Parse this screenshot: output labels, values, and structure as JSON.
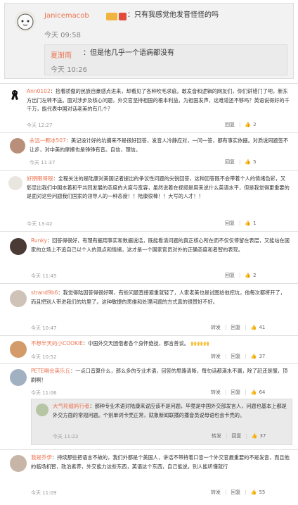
{
  "top_post": {
    "user_name": "Janicemacob",
    "text": "：只有我感觉他发音怪怪的吗",
    "time": "今天 09:58",
    "reply": {
      "user_name": "夏澍雨",
      "text": "：但是他几乎一个语病都没有",
      "time": "今天 10:26"
    }
  },
  "comments": [
    {
      "user_name": "Ann0102",
      "text": "：捡着骄傲的民族自豪感点进来，却看见了各种吹毛求疵。敢发音和逻辑的网友们，你们讲错门了吧，新东方出门左转不送。面对涉步及核心问题，外交官坚持祖国的根本利益，为祖国发声，这难道还不够吗？英语说得好的千千万，能代表中国对话老美的有几个？",
      "time": "今天 12:27",
      "likes": "2"
    },
    {
      "user_name": "永远一颗冰507",
      "text": "：美记设计好的坑摘来不是很好回答，发音人冷静应对，一问一答，都有事实依据。对质说同题签不让步，对中美的摩擦也是铮铮有音。自信，理信。",
      "time": "今天 11:37",
      "likes": "5"
    },
    {
      "user_name": "好朋眼哥程",
      "text": "：全程关注的是陆康对美国记者提出的争议性问题的尖锐回答，这种回答既不会带着个人的情绪色彩，又彰显出我们中国本着和平共同发展的态度的大度与宽容，虽然说着在视频是用来说什么英语水平，但是我觉得更重要的是面对这些问题我们国家的领导人的一种态度！！陆康很棒！！大写的人才！！",
      "time": "今天 13:42",
      "likes": "1"
    },
    {
      "user_name": "Runky",
      "text": "：回答得很好，有理有据用事实和数据说话，既能看清问题的真正核心所在而不仅仅停留在表层，又能站在国家的立场上不追自己以个人的观点和情绪，这才是一个国家官员对外的正确态度和者智的表现。",
      "time": "今天 11:45",
      "likes": "2"
    },
    {
      "user_name": "strand9b6",
      "text": "：我觉得陆因答得很好啊，有些问题直接避重就轻了，人家老美也是试图给他挖坑，他每次都将开了，而且把别人带进我们的坑里了。这种敏捷的思维和处理问题的方式真的很赞好不好。",
      "time": "今天 10:47",
      "likes": "41"
    },
    {
      "user_name": "不想半天的小COOKIE",
      "text": "：中国外交天团借者各个身怀绝技，都言善谈。",
      "time": "今天 10:52",
      "likes": "37"
    },
    {
      "user_name": "PETE唱会英乐丘",
      "text": "：一点口音算什么，那么多的专业术语，回答的思路清晰，每句话都滴水不漏，除了赶还是服，顶刷啊！",
      "time": "今天 11:06",
      "likes": "64",
      "reply": {
        "user_name": "大气轮缝妈行者",
        "text": "：那种专业术语对陆康来说应该不是问题，毕竟是中国外交部发言人，问题也基本上都是外交方面的常规问题。个别单词卡壳正常，就象新闻联播的播音员说母语也会卡壳的。",
        "time": "今天 11:22",
        "likes": "37"
      }
    },
    {
      "user_name": "我是乔伊",
      "text": "：持续那些把语言不故的，我们外都是个美国人，讲话不带持着口音一个外交官最重要的不是发音，而且他的临场机智，政治素养，外交能力这些东西，英语这个东西，自己能说，别人能听懂就行",
      "time": "今天 11:09",
      "likes": "55"
    }
  ],
  "actions": {
    "share": "转发",
    "reply": "回复"
  }
}
